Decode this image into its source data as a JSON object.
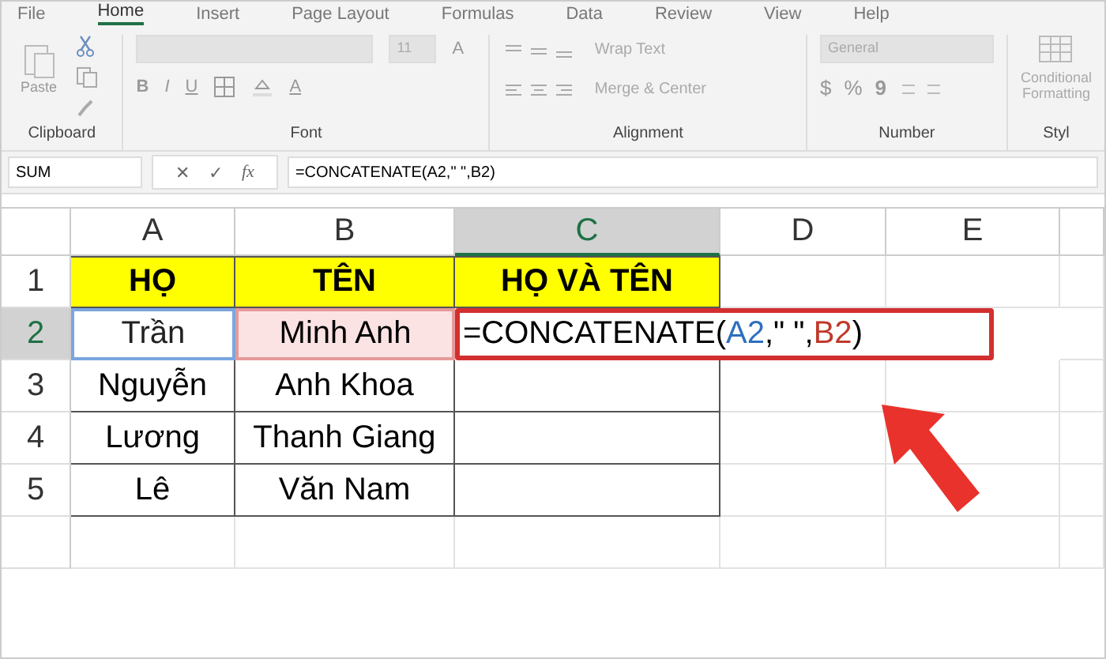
{
  "ribbon_tabs": [
    {
      "label": "File",
      "selected": false
    },
    {
      "label": "Home",
      "selected": true
    },
    {
      "label": "Insert",
      "selected": false
    },
    {
      "label": "Page Layout",
      "selected": false
    },
    {
      "label": "Formulas",
      "selected": false
    },
    {
      "label": "Data",
      "selected": false
    },
    {
      "label": "Review",
      "selected": false
    },
    {
      "label": "View",
      "selected": false
    },
    {
      "label": "Help",
      "selected": false
    }
  ],
  "ribbon": {
    "paste_label": "Paste",
    "font_size": "11",
    "grow_font": "A",
    "font_buttons": [
      "B",
      "I",
      "U"
    ],
    "font_color": "A",
    "wrap_text": "Wrap Text",
    "merge_center": "Merge & Center",
    "number_format": "General",
    "currency": "$",
    "percent": "%",
    "comma": "9",
    "conditional_formatting": [
      "Conditional",
      "Formatting"
    ],
    "groups": [
      "Clipboard",
      "Font",
      "Alignment",
      "Number",
      "Styl"
    ]
  },
  "formula_bar": {
    "name_box": "SUM",
    "icons": [
      "✕",
      "✓",
      "fx"
    ],
    "formula": "=CONCATENATE(A2,\" \",B2)"
  },
  "columns": [
    {
      "label": "A",
      "selected": false
    },
    {
      "label": "B",
      "selected": false
    },
    {
      "label": "C",
      "selected": true
    },
    {
      "label": "D",
      "selected": false
    },
    {
      "label": "E",
      "selected": false
    }
  ],
  "rows": [
    {
      "number": "1",
      "selected": false,
      "cells": [
        {
          "kind": "header",
          "text": "HỌ"
        },
        {
          "kind": "header",
          "text": "TÊN"
        },
        {
          "kind": "header",
          "text": "HỌ VÀ TÊN"
        }
      ]
    },
    {
      "number": "2",
      "selected": true,
      "cells": [
        {
          "kind": "ref_a",
          "text": "Trần"
        },
        {
          "kind": "ref_b",
          "text": "Minh Anh"
        },
        {
          "kind": "formula",
          "segments": [
            {
              "text": "=CONCATENATE(",
              "color": "#000000"
            },
            {
              "text": "A2",
              "color": "#2f6fbd"
            },
            {
              "text": ",\" \",",
              "color": "#000000"
            },
            {
              "text": "B2",
              "color": "#c0392b"
            },
            {
              "text": ")",
              "color": "#000000"
            }
          ]
        }
      ]
    },
    {
      "number": "3",
      "selected": false,
      "cells": [
        {
          "kind": "plain",
          "text": "Nguyễn"
        },
        {
          "kind": "plain",
          "text": "Anh Khoa"
        },
        {
          "kind": "blank"
        }
      ]
    },
    {
      "number": "4",
      "selected": false,
      "cells": [
        {
          "kind": "plain",
          "text": "Lương"
        },
        {
          "kind": "plain",
          "text": "Thanh Giang"
        },
        {
          "kind": "blank"
        }
      ]
    },
    {
      "number": "5",
      "selected": false,
      "cells": [
        {
          "kind": "plain",
          "text": "Lê"
        },
        {
          "kind": "plain",
          "text": "Văn Nam"
        },
        {
          "kind": "blank"
        }
      ]
    }
  ]
}
